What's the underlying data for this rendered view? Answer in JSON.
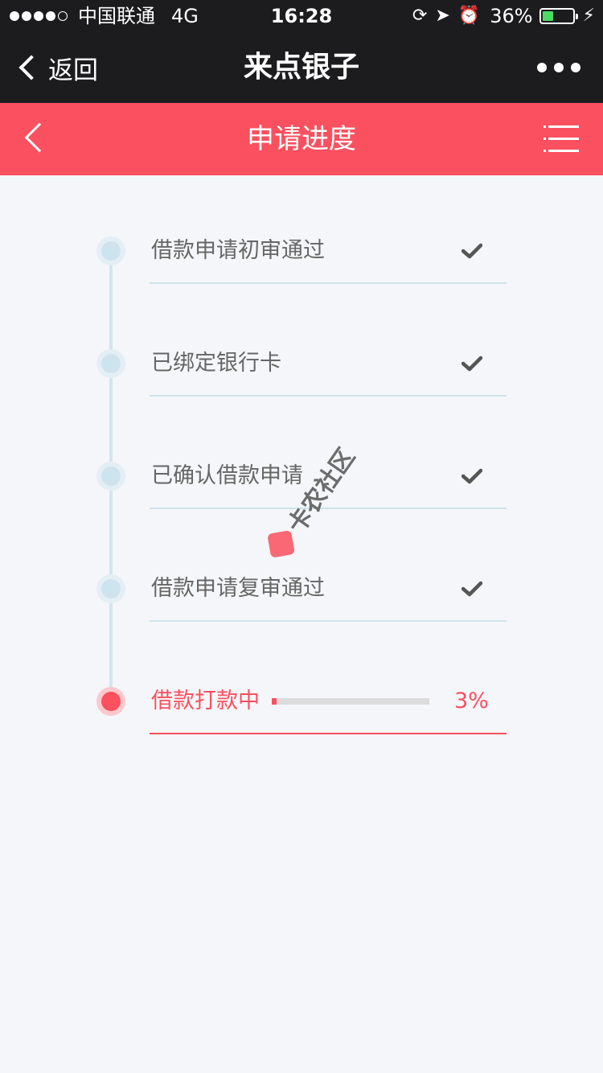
{
  "status_bar": {
    "carrier": "中国联通",
    "network": "4G",
    "time": "16:28",
    "battery_percent": "36%",
    "battery_level": 0.36
  },
  "nav": {
    "back_label": "返回",
    "title": "来点银子"
  },
  "header": {
    "title": "申请进度"
  },
  "steps": [
    {
      "label": "借款申请初审通过",
      "status": "done"
    },
    {
      "label": "已绑定银行卡",
      "status": "done"
    },
    {
      "label": "已确认借款申请",
      "status": "done"
    },
    {
      "label": "借款申请复审通过",
      "status": "done"
    },
    {
      "label": "借款打款中",
      "status": "in-progress",
      "progress_text": "3%",
      "progress": 0.03
    }
  ],
  "watermark": "卡农社区",
  "colors": {
    "accent": "#fb505f",
    "nav_bg": "#1c1c1e",
    "page_bg": "#f5f6f9",
    "timeline": "#d3e6ef"
  }
}
